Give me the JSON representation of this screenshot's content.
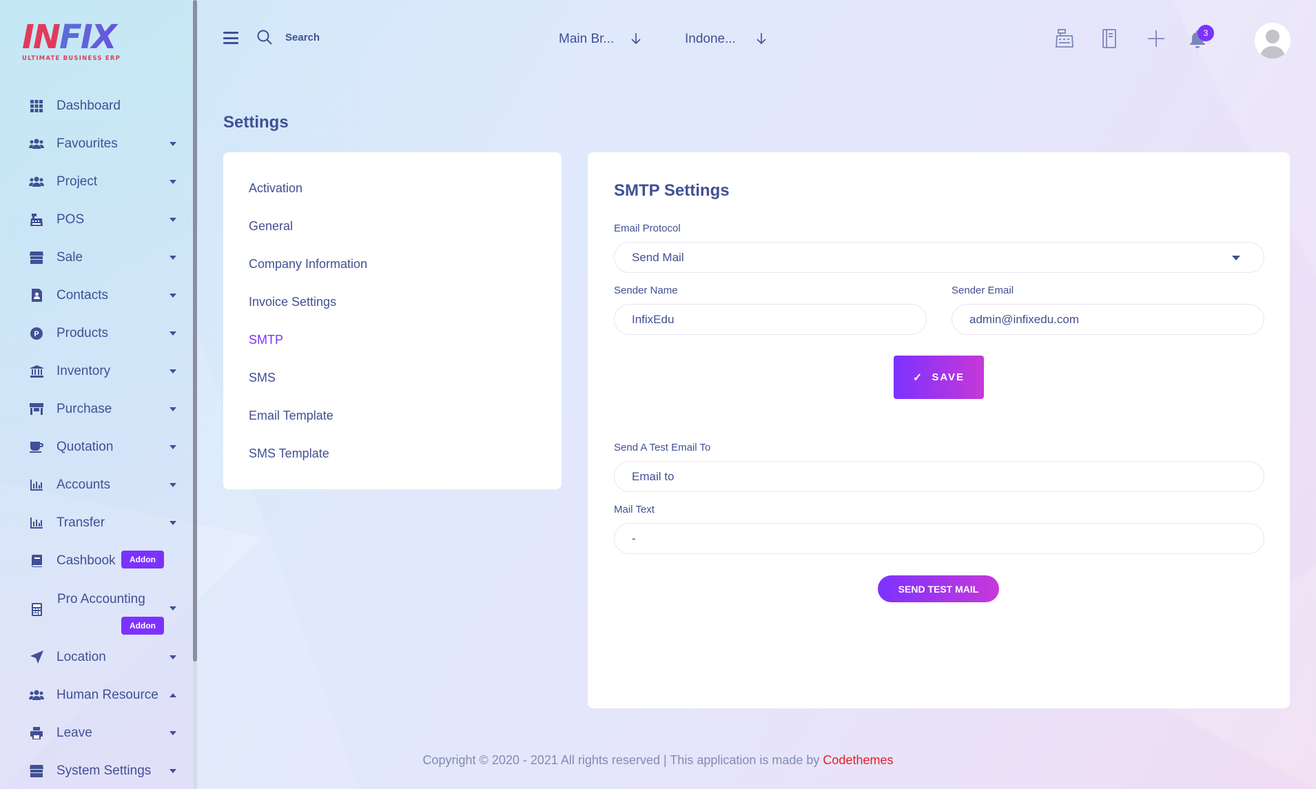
{
  "brand": {
    "logo_text": "INFIX",
    "tagline": "ULTIMATE BUSINESS ERP"
  },
  "sidebar": {
    "items": [
      {
        "label": "Dashboard",
        "icon": "grid-icon"
      },
      {
        "label": "Favourites",
        "icon": "users-icon"
      },
      {
        "label": "Project",
        "icon": "users-icon"
      },
      {
        "label": "POS",
        "icon": "cash-register-icon"
      },
      {
        "label": "Sale",
        "icon": "store-icon"
      },
      {
        "label": "Contacts",
        "icon": "contact-book-icon"
      },
      {
        "label": "Products",
        "icon": "product-p-icon"
      },
      {
        "label": "Inventory",
        "icon": "bank-icon"
      },
      {
        "label": "Purchase",
        "icon": "shop-icon"
      },
      {
        "label": "Quotation",
        "icon": "coffee-cup-icon"
      },
      {
        "label": "Accounts",
        "icon": "bar-chart-icon"
      },
      {
        "label": "Transfer",
        "icon": "bar-chart-icon"
      },
      {
        "label": "Cashbook",
        "icon": "book-icon",
        "badge": "Addon"
      },
      {
        "label": "Pro Accounting",
        "icon": "calculator-icon",
        "badge": "Addon"
      },
      {
        "label": "Location",
        "icon": "location-arrow-icon"
      },
      {
        "label": "Human Resource",
        "icon": "users-icon"
      },
      {
        "label": "Leave",
        "icon": "printer-icon"
      },
      {
        "label": "System Settings",
        "icon": "store-icon"
      }
    ]
  },
  "header": {
    "search_placeholder": "Search",
    "branch_select": "Main Br...",
    "language_select": "Indone...",
    "notification_count": "3",
    "icons": [
      "hamburger-icon",
      "search-icon",
      "cash-register-icon",
      "notebook-icon",
      "plus-icon",
      "bell-icon",
      "avatar"
    ]
  },
  "page": {
    "title": "Settings"
  },
  "settings_menu": {
    "items": [
      "Activation",
      "General",
      "Company Information",
      "Invoice Settings",
      "SMTP",
      "SMS",
      "Email Template",
      "SMS Template"
    ],
    "active": "SMTP"
  },
  "smtp_form": {
    "title": "SMTP Settings",
    "email_protocol_label": "Email Protocol",
    "email_protocol_value": "Send Mail",
    "sender_name_label": "Sender Name",
    "sender_name_value": "InfixEdu",
    "sender_email_label": "Sender Email",
    "sender_email_value": "admin@infixedu.com",
    "save_label": "SAVE",
    "test_email_label": "Send A Test Email To",
    "test_email_placeholder": "Email to",
    "mail_text_label": "Mail Text",
    "mail_text_value": "-",
    "send_test_label": "SEND TEST MAIL"
  },
  "footer": {
    "text": "Copyright © 2020 - 2021 All rights reserved | This application is made by ",
    "credit": "Codethemes"
  },
  "colors": {
    "accent": "#7c32ff",
    "accent_end": "#c738d8",
    "text": "#415094",
    "credit": "#e31e25"
  }
}
